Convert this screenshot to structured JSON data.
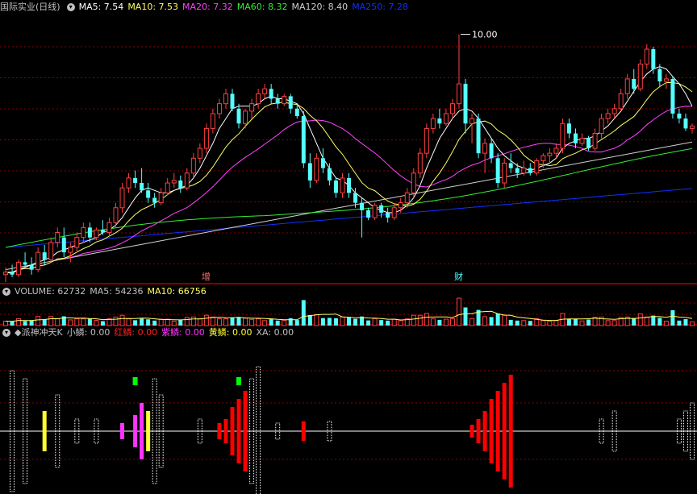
{
  "colors": {
    "background": "#000000",
    "grid": "#8b0000",
    "separator": "#b00000",
    "up": "#ff4040",
    "down": "#54ffff",
    "ma5": "#ffffff",
    "ma10": "#ffff66",
    "ma20": "#ff44ff",
    "ma60": "#33ee33",
    "ma120": "#cfcfcf",
    "ma250": "#1030ff",
    "xiao": "#ffffff",
    "hong": "#ff0000",
    "zi": "#ff33ff",
    "huang": "#ffff33"
  },
  "main": {
    "title": "国际实业(日线)",
    "ma5_label": "MA5: 7.54",
    "ma10_label": "MA10: 7.53",
    "ma20_label": "MA20: 7.32",
    "ma60_label": "MA60: 8.32",
    "ma120_label": "MA120: 8.40",
    "ma250_label": "MA250: 7.28",
    "peak_label": "10.00",
    "marker1": "增",
    "marker2": "财"
  },
  "volume": {
    "title": "VOLUME: 62732",
    "ma5_label": "MA5: 54236",
    "ma10_label": "MA10: 66756"
  },
  "indicator": {
    "title": "◆派神冲天K",
    "xiao_label": "小鳞: 0.00",
    "hong_label": "红鳞: 0.00",
    "zi_label": "紫鳞: 0.00",
    "huang_label": "黄鳞: 0.00",
    "xa_label": "XA: 0.00"
  },
  "chart_data": {
    "type": "candlestick",
    "price_range": [
      5.0,
      10.4
    ],
    "peak": 10.0,
    "ohlc": [
      [
        5.15,
        5.3,
        5.0,
        5.2
      ],
      [
        5.2,
        5.35,
        5.1,
        5.15
      ],
      [
        5.15,
        5.45,
        5.1,
        5.4
      ],
      [
        5.4,
        5.6,
        5.3,
        5.35
      ],
      [
        5.35,
        5.5,
        5.15,
        5.25
      ],
      [
        5.25,
        5.7,
        5.2,
        5.6
      ],
      [
        5.6,
        5.75,
        5.35,
        5.45
      ],
      [
        5.45,
        5.9,
        5.4,
        5.8
      ],
      [
        5.8,
        6.1,
        5.7,
        6.0
      ],
      [
        5.9,
        6.1,
        5.5,
        5.6
      ],
      [
        5.6,
        5.8,
        5.4,
        5.7
      ],
      [
        5.7,
        6.0,
        5.6,
        5.9
      ],
      [
        5.9,
        6.2,
        5.8,
        6.1
      ],
      [
        6.1,
        6.2,
        5.8,
        5.9
      ],
      [
        5.9,
        6.1,
        5.85,
        6.05
      ],
      [
        6.05,
        6.25,
        5.95,
        6.0
      ],
      [
        6.0,
        6.3,
        5.9,
        6.2
      ],
      [
        6.2,
        6.6,
        6.1,
        6.5
      ],
      [
        6.5,
        7.0,
        6.4,
        6.9
      ],
      [
        6.9,
        7.2,
        6.8,
        7.1
      ],
      [
        7.1,
        7.25,
        6.9,
        7.0
      ],
      [
        7.0,
        7.3,
        6.8,
        6.85
      ],
      [
        6.85,
        7.0,
        6.6,
        6.7
      ],
      [
        6.7,
        6.8,
        6.5,
        6.6
      ],
      [
        6.6,
        6.9,
        6.55,
        6.8
      ],
      [
        6.8,
        7.1,
        6.75,
        7.0
      ],
      [
        7.0,
        7.2,
        6.9,
        7.05
      ],
      [
        7.05,
        7.15,
        6.8,
        6.9
      ],
      [
        6.9,
        7.3,
        6.85,
        7.2
      ],
      [
        7.2,
        7.6,
        7.1,
        7.5
      ],
      [
        7.5,
        7.8,
        7.4,
        7.7
      ],
      [
        7.7,
        8.2,
        7.6,
        8.1
      ],
      [
        8.1,
        8.5,
        8.0,
        8.4
      ],
      [
        8.4,
        8.7,
        8.3,
        8.6
      ],
      [
        8.6,
        8.9,
        8.5,
        8.8
      ],
      [
        8.8,
        8.9,
        8.45,
        8.5
      ],
      [
        8.5,
        8.6,
        8.1,
        8.2
      ],
      [
        8.2,
        8.5,
        8.1,
        8.45
      ],
      [
        8.45,
        8.7,
        8.3,
        8.6
      ],
      [
        8.6,
        8.9,
        8.5,
        8.8
      ],
      [
        8.8,
        9.0,
        8.7,
        8.9
      ],
      [
        8.9,
        9.0,
        8.6,
        8.7
      ],
      [
        8.7,
        8.8,
        8.5,
        8.6
      ],
      [
        8.6,
        8.8,
        8.55,
        8.75
      ],
      [
        8.75,
        8.8,
        8.4,
        8.5
      ],
      [
        8.5,
        8.6,
        8.3,
        8.35
      ],
      [
        8.35,
        8.45,
        7.3,
        7.4
      ],
      [
        7.4,
        7.6,
        6.9,
        7.05
      ],
      [
        7.05,
        7.6,
        7.0,
        7.5
      ],
      [
        7.5,
        7.7,
        7.2,
        7.3
      ],
      [
        7.3,
        7.4,
        6.95,
        7.05
      ],
      [
        7.05,
        7.1,
        6.7,
        6.8
      ],
      [
        6.8,
        7.2,
        6.7,
        7.1
      ],
      [
        7.1,
        7.2,
        6.7,
        6.8
      ],
      [
        6.8,
        6.9,
        6.5,
        6.6
      ],
      [
        6.6,
        6.7,
        5.9,
        6.45
      ],
      [
        6.45,
        6.5,
        6.25,
        6.3
      ],
      [
        6.3,
        6.6,
        6.25,
        6.55
      ],
      [
        6.55,
        6.6,
        6.3,
        6.4
      ],
      [
        6.4,
        6.5,
        6.2,
        6.3
      ],
      [
        6.3,
        6.6,
        6.25,
        6.5
      ],
      [
        6.5,
        6.7,
        6.4,
        6.6
      ],
      [
        6.6,
        6.9,
        6.5,
        6.8
      ],
      [
        6.8,
        7.3,
        6.7,
        7.2
      ],
      [
        7.2,
        7.7,
        7.1,
        7.6
      ],
      [
        7.6,
        8.2,
        7.5,
        8.1
      ],
      [
        8.1,
        8.4,
        8.0,
        8.3
      ],
      [
        8.3,
        8.5,
        8.1,
        8.2
      ],
      [
        8.2,
        8.5,
        8.15,
        8.4
      ],
      [
        8.4,
        8.7,
        8.3,
        8.6
      ],
      [
        8.6,
        10.0,
        8.5,
        9.0
      ],
      [
        9.0,
        9.1,
        8.0,
        8.2
      ],
      [
        8.2,
        8.4,
        7.8,
        8.3
      ],
      [
        8.3,
        8.4,
        7.5,
        7.6
      ],
      [
        7.6,
        7.9,
        7.2,
        7.8
      ],
      [
        7.8,
        7.9,
        7.4,
        7.5
      ],
      [
        7.5,
        7.6,
        6.9,
        7.0
      ],
      [
        7.0,
        7.5,
        6.9,
        7.4
      ],
      [
        7.4,
        7.6,
        7.2,
        7.3
      ],
      [
        7.3,
        7.4,
        7.1,
        7.2
      ],
      [
        7.2,
        7.45,
        7.15,
        7.3
      ],
      [
        7.3,
        7.4,
        7.15,
        7.2
      ],
      [
        7.2,
        7.5,
        7.15,
        7.45
      ],
      [
        7.45,
        7.6,
        7.3,
        7.55
      ],
      [
        7.55,
        7.7,
        7.4,
        7.6
      ],
      [
        7.6,
        7.8,
        7.5,
        7.7
      ],
      [
        7.7,
        8.3,
        7.6,
        8.2
      ],
      [
        8.2,
        8.3,
        7.9,
        8.0
      ],
      [
        8.0,
        8.1,
        7.7,
        7.8
      ],
      [
        7.8,
        8.0,
        7.75,
        7.9
      ],
      [
        7.9,
        7.95,
        7.65,
        7.7
      ],
      [
        7.7,
        8.1,
        7.65,
        8.0
      ],
      [
        8.0,
        8.4,
        7.9,
        8.3
      ],
      [
        8.3,
        8.5,
        8.2,
        8.4
      ],
      [
        8.4,
        8.6,
        8.3,
        8.5
      ],
      [
        8.5,
        8.9,
        8.45,
        8.8
      ],
      [
        8.8,
        9.2,
        8.7,
        9.1
      ],
      [
        9.1,
        9.3,
        8.8,
        8.9
      ],
      [
        8.9,
        9.5,
        8.85,
        9.4
      ],
      [
        9.4,
        9.8,
        9.3,
        9.7
      ],
      [
        9.7,
        9.75,
        9.2,
        9.3
      ],
      [
        9.3,
        9.4,
        8.95,
        9.05
      ],
      [
        9.05,
        9.2,
        8.9,
        9.1
      ],
      [
        9.1,
        9.15,
        8.3,
        8.4
      ],
      [
        8.4,
        8.5,
        8.2,
        8.3
      ],
      [
        8.3,
        8.4,
        8.05,
        8.1
      ],
      [
        8.1,
        8.2,
        8.0,
        8.15
      ]
    ],
    "ma5": [
      5.2,
      5.2,
      5.25,
      5.3,
      5.35,
      5.4,
      5.45,
      5.5,
      5.6,
      5.65,
      5.7,
      5.75,
      5.8,
      5.85,
      5.9,
      6.0,
      6.05,
      6.15,
      6.3,
      6.5,
      6.7,
      6.85,
      6.9,
      6.85,
      6.8,
      6.8,
      6.85,
      6.9,
      6.95,
      7.1,
      7.3,
      7.55,
      7.8,
      8.1,
      8.3,
      8.5,
      8.55,
      8.55,
      8.55,
      8.6,
      8.7,
      8.75,
      8.7,
      8.7,
      8.65,
      8.6,
      8.4,
      8.1,
      7.8,
      7.5,
      7.3,
      7.1,
      7.05,
      6.95,
      6.8,
      6.7,
      6.6,
      6.5,
      6.45,
      6.4,
      6.4,
      6.45,
      6.55,
      6.7,
      6.95,
      7.3,
      7.6,
      7.9,
      8.1,
      8.3,
      8.45,
      8.5,
      8.45,
      8.3,
      8.1,
      7.9,
      7.7,
      7.55,
      7.45,
      7.35,
      7.3,
      7.25,
      7.3,
      7.35,
      7.4,
      7.5,
      7.7,
      7.8,
      7.85,
      7.9,
      7.9,
      7.95,
      8.05,
      8.15,
      8.3,
      8.45,
      8.65,
      8.85,
      9.05,
      9.2,
      9.3,
      9.35,
      9.3,
      9.15,
      9.0,
      8.8,
      8.55
    ]
  }
}
